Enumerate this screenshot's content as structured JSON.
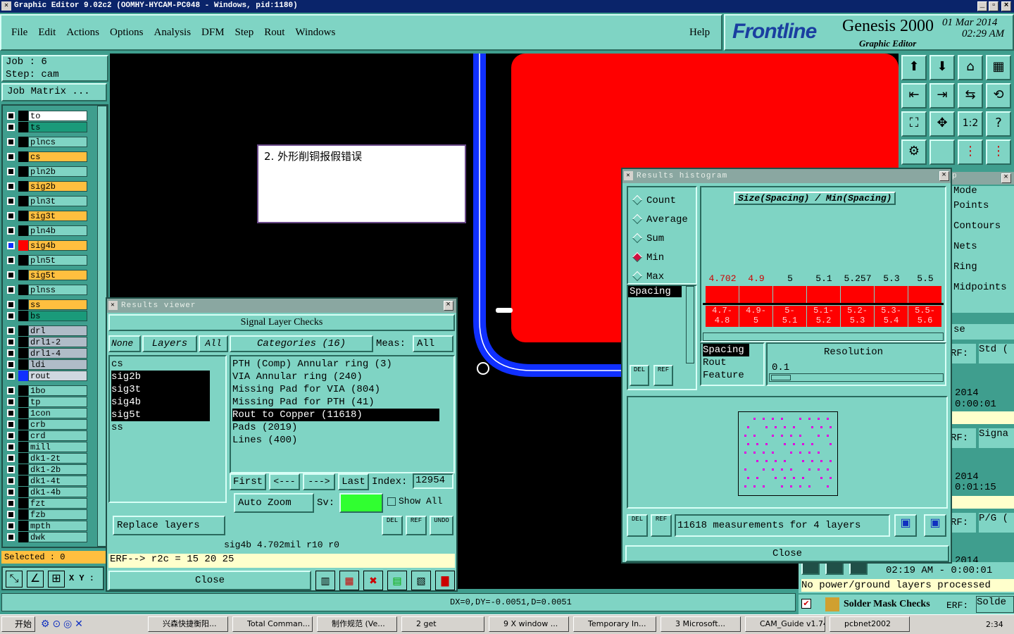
{
  "window_title": "Graphic Editor 9.02c2 (OOMHY-HYCAM-PC048 - Windows, pid:1180)",
  "menu": [
    "File",
    "Edit",
    "Actions",
    "Options",
    "Analysis",
    "DFM",
    "Step",
    "Rout",
    "Windows"
  ],
  "help_label": "Help",
  "brand": {
    "logo": "Frontline",
    "product": "Genesis 2000",
    "subtitle": "Graphic Editor",
    "date": "01 Mar 2014",
    "time": "02:29 AM"
  },
  "job": {
    "job_line": "Job  :  6",
    "step_line": "Step: cam",
    "matrix_btn": "Job Matrix ..."
  },
  "layers": [
    {
      "name": "to",
      "color": "#ffffff"
    },
    {
      "name": "ts",
      "color": "#1a9a7a"
    },
    {
      "name": "plncs",
      "color": "#7fd4c4"
    },
    {
      "name": "cs",
      "color": "#ffbf3f"
    },
    {
      "name": "pln2b",
      "color": "#7fd4c4"
    },
    {
      "name": "sig2b",
      "color": "#ffbf3f"
    },
    {
      "name": "pln3t",
      "color": "#7fd4c4"
    },
    {
      "name": "sig3t",
      "color": "#ffbf3f"
    },
    {
      "name": "pln4b",
      "color": "#7fd4c4"
    },
    {
      "name": "sig4b",
      "color": "#ffbf3f"
    },
    {
      "name": "pln5t",
      "color": "#7fd4c4"
    },
    {
      "name": "sig5t",
      "color": "#ffbf3f"
    },
    {
      "name": "plnss",
      "color": "#7fd4c4"
    },
    {
      "name": "ss",
      "color": "#ffbf3f"
    },
    {
      "name": "bs",
      "color": "#1a9a7a"
    },
    {
      "name": "drl",
      "color": "#b0bcc8"
    },
    {
      "name": "drl1-2",
      "color": "#b0bcc8"
    },
    {
      "name": "drl1-4",
      "color": "#b0bcc8"
    },
    {
      "name": "ldi",
      "color": "#b0bcc8"
    },
    {
      "name": "rout",
      "color": "#d0d8e0"
    },
    {
      "name": "1bo",
      "color": "#7fd4c4"
    },
    {
      "name": "tp",
      "color": "#7fd4c4"
    },
    {
      "name": "1con",
      "color": "#7fd4c4"
    },
    {
      "name": "crb",
      "color": "#7fd4c4"
    },
    {
      "name": "crd",
      "color": "#7fd4c4"
    },
    {
      "name": "mill",
      "color": "#7fd4c4"
    },
    {
      "name": "dk1-2t",
      "color": "#7fd4c4"
    },
    {
      "name": "dk1-2b",
      "color": "#7fd4c4"
    },
    {
      "name": "dk1-4t",
      "color": "#7fd4c4"
    },
    {
      "name": "dk1-4b",
      "color": "#7fd4c4"
    },
    {
      "name": "fzt",
      "color": "#7fd4c4"
    },
    {
      "name": "fzb",
      "color": "#7fd4c4"
    },
    {
      "name": "mpth",
      "color": "#7fd4c4"
    },
    {
      "name": "dwk",
      "color": "#7fd4c4"
    }
  ],
  "selected_label": "Selected : 0",
  "xy_label": "X Y :",
  "status_line": "DX=0,DY=-0.0051,D=0.0051",
  "note_text": "2. 外形削铜报假错误",
  "results_viewer": {
    "title": "Results viewer",
    "header": "Signal Layer Checks",
    "none_label": "None",
    "layers_label": "Layers",
    "all_label": "All",
    "categories_label": "Categories (16)",
    "meas_label": "Meas:",
    "meas_value": "All",
    "layer_list": [
      "cs",
      "sig2b",
      "sig3t",
      "sig4b",
      "sig5t",
      "ss"
    ],
    "category_list": [
      "PTH (Comp) Annular ring (3)",
      "VIA Annular ring (240)",
      "Missing Pad for VIA (804)",
      "Missing Pad for PTH (41)",
      "Rout to Copper (11618)",
      "Pads (2019)",
      "Lines (400)"
    ],
    "first_label": "First",
    "prev_label": "<---",
    "next_label": "--->",
    "last_label": "Last",
    "index_label": "Index:",
    "index_value": "12954",
    "auto_zoom_label": "Auto Zoom",
    "sv_label": "Sv:",
    "show_all_label": "Show All",
    "replace_label": "Replace layers",
    "del_label": "DEL",
    "ref_label": "REF",
    "undo_label": "UNDO",
    "info_line": "sig4b 4.702mil  r10  r0",
    "erf_line": "ERF--> r2c = 15 20 25",
    "close_label": "Close"
  },
  "histogram": {
    "title": "Results histogram",
    "radios": [
      {
        "label": "Count",
        "on": false
      },
      {
        "label": "Average",
        "on": false
      },
      {
        "label": "Sum",
        "on": false
      },
      {
        "label": "Min",
        "on": true
      },
      {
        "label": "Max",
        "on": false
      }
    ],
    "chart_title": "Size(Spacing) / Min(Spacing)",
    "bar_values": [
      "4.702",
      "4.9",
      "5",
      "5.1",
      "5.257",
      "5.3",
      "5.5"
    ],
    "bin_labels": [
      [
        "4.7-",
        "4.8"
      ],
      [
        "4.9-",
        "5"
      ],
      [
        "5-",
        "5.1"
      ],
      [
        "5.1-",
        "5.2"
      ],
      [
        "5.2-",
        "5.3"
      ],
      [
        "5.3-",
        "5.4"
      ],
      [
        "5.5-",
        "5.6"
      ]
    ],
    "spacing_label": "Spacing",
    "attr_list": [
      "Spacing",
      "Rout",
      "Feature"
    ],
    "resolution_label": "Resolution",
    "resolution_value": "0.1",
    "summary": "11618 measurements for 4 layers",
    "close_label": "Close",
    "del_label": "DEL",
    "ref_label": "REF"
  },
  "side_panel": {
    "mode_items": [
      "Mode",
      "Points",
      "Contours",
      "Nets",
      "Ring",
      "Midpoints"
    ],
    "se_label": "se",
    "erf1": "RF:",
    "std": "Std (",
    "yr1": "2014",
    "t1": "0:00:01",
    "erf2": "RF:",
    "signa": "Signa",
    "yr2": "2014",
    "t2": "0:01:15",
    "erf3": "RF:",
    "pg": "P/G (",
    "yr3": "2014",
    "t3": "02:19 AM - 0:00:01",
    "no_pg": "No power/ground layers processed",
    "solder_mask": "Solder Mask Checks",
    "erf4": "ERF:",
    "solde": "Solde"
  },
  "taskbar": {
    "start": "开始",
    "items": [
      "兴森快捷衡阳...",
      "Total Comman...",
      "制作规范 (Ve...",
      "2 get",
      "9 X window ...",
      "Temporary In...",
      "3 Microsoft...",
      "CAM_Guide v1.74",
      "pcbnet2002"
    ],
    "clock": "2:34"
  }
}
